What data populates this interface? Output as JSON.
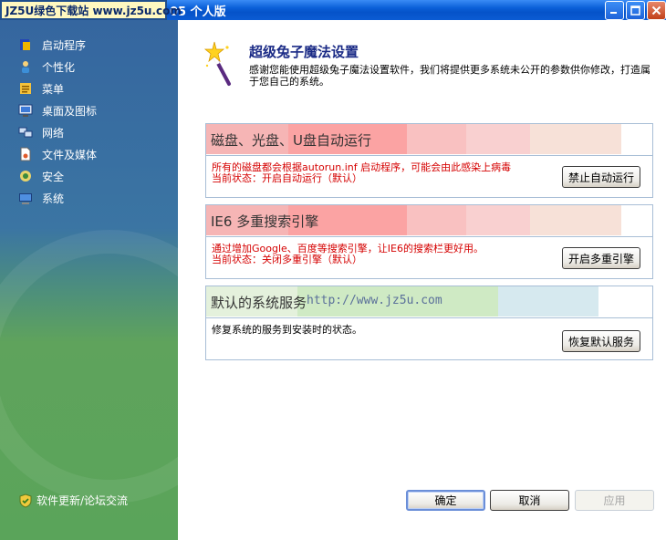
{
  "window": {
    "watermark": "JZ5U绿色下载站 www.jz5u.com",
    "title": "05  个人版"
  },
  "sidebar": {
    "items": [
      {
        "label": "启动程序",
        "icon": "startup-icon"
      },
      {
        "label": "个性化",
        "icon": "personalize-icon"
      },
      {
        "label": "菜单",
        "icon": "menu-icon"
      },
      {
        "label": "桌面及图标",
        "icon": "desktop-icon"
      },
      {
        "label": "网络",
        "icon": "network-icon"
      },
      {
        "label": "文件及媒体",
        "icon": "file-media-icon"
      },
      {
        "label": "安全",
        "icon": "security-icon"
      },
      {
        "label": "系统",
        "icon": "system-icon"
      }
    ],
    "footer": "软件更新/论坛交流"
  },
  "header": {
    "title": "超级兔子魔法设置",
    "desc": "感谢您能使用超级兔子魔法设置软件，我们将提供更多系统未公开的参数供你修改，打造属于您自己的系统。"
  },
  "sections": [
    {
      "title": "磁盘、光盘、U盘自动运行",
      "line1": "所有的磁盘都会根据autorun.inf 启动程序，可能会由此感染上病毒",
      "line2": "当前状态：开启自动运行（默认）",
      "button": "禁止自动运行"
    },
    {
      "title": "IE6 多重搜索引擎",
      "line1": "通过增加Google、百度等搜索引擎，让IE6的搜索栏更好用。",
      "line2": "当前状态：关闭多重引擎（默认）",
      "button": "开启多重引擎"
    },
    {
      "title": "默认的系统服务",
      "url": "http://www.jz5u.com",
      "line1": "修复系统的服务到安装时的状态。",
      "button": "恢复默认服务"
    }
  ],
  "footer_buttons": {
    "ok": "确定",
    "cancel": "取消",
    "apply": "应用"
  },
  "colors": {
    "title_bar": "#0553c9",
    "status_red": "#d50000",
    "header_title": "#1b2b86",
    "section_border": "#a8bed6"
  }
}
